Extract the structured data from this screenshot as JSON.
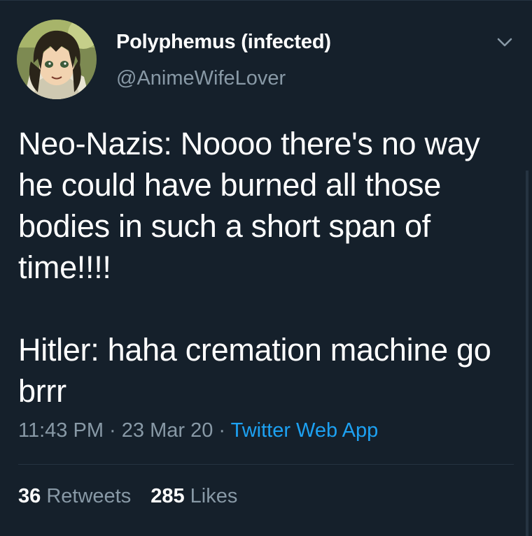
{
  "user": {
    "display_name": "Polyphemus (infected)",
    "handle": "@AnimeWifeLover",
    "avatar_icon": "anime-character-avatar"
  },
  "tweet": {
    "text": "Neo-Nazis: Noooo there's no way\nhe could have burned all those\nbodies in such a short span of\ntime!!!!\n\nHitler: haha cremation machine go\nbrrr"
  },
  "meta": {
    "time": "11:43 PM",
    "separator": " · ",
    "date": "23 Mar 20",
    "source": "Twitter Web App"
  },
  "stats": {
    "retweets_count": "36",
    "retweets_label": "Retweets",
    "likes_count": "285",
    "likes_label": "Likes"
  },
  "colors": {
    "background": "#15202b",
    "secondary_text": "#8899a6",
    "accent": "#1da1f2",
    "divider": "#253341"
  }
}
